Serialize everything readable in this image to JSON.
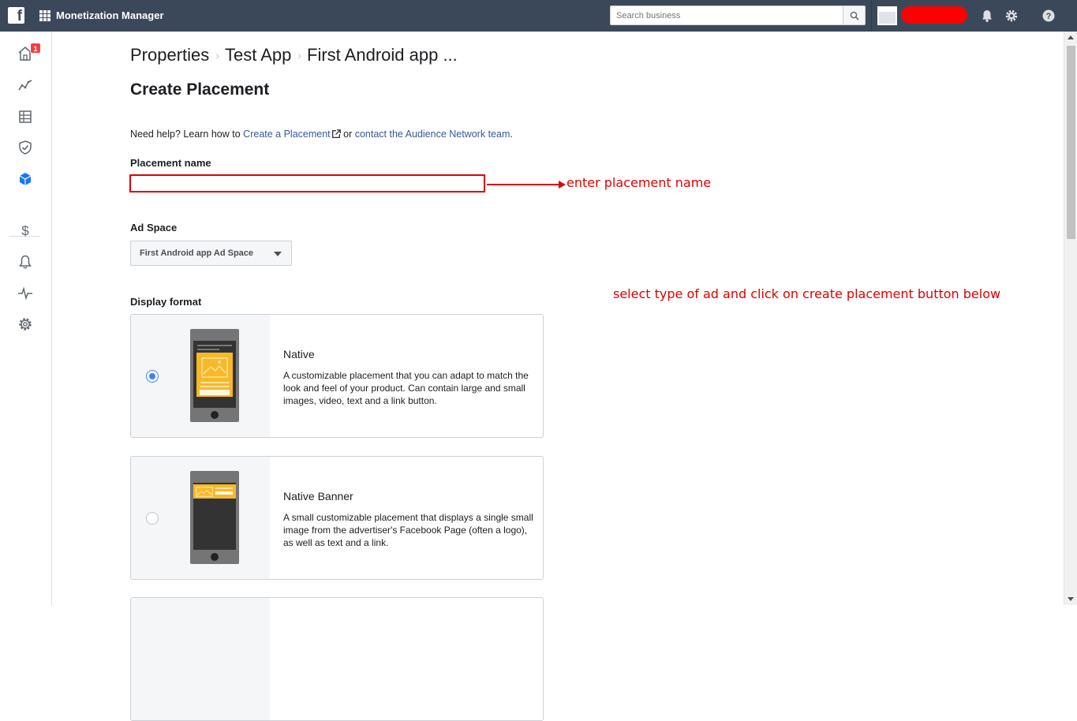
{
  "topbar": {
    "app_title": "Monetization Manager",
    "search_placeholder": "Search business"
  },
  "leftrail": {
    "home_badge": "1",
    "items": [
      "home-icon",
      "analytics-icon",
      "properties-icon",
      "integrity-icon",
      "placements-icon",
      "payout-icon",
      "notifications-icon",
      "activity-icon",
      "settings-icon"
    ]
  },
  "breadcrumb": {
    "items": [
      "Properties",
      "Test App",
      "First Android app ..."
    ]
  },
  "page_title": "Create Placement",
  "help": {
    "prefix": "Need help? Learn how to ",
    "link1": "Create a Placement",
    "middle": " or ",
    "link2": "contact the Audience Network team",
    "suffix": "."
  },
  "placement_name": {
    "label": "Placement name",
    "value": ""
  },
  "ad_space": {
    "label": "Ad Space",
    "selected": "First Android app Ad Space"
  },
  "display_format": {
    "label": "Display format",
    "options": [
      {
        "title": "Native",
        "description": "A customizable placement that you can adapt to match the look and feel of your product. Can contain large and small images, video, text and a link button.",
        "selected": true
      },
      {
        "title": "Native Banner",
        "description": "A small customizable placement that displays a single small image from the advertiser's Facebook Page (often a logo), as well as text and a link.",
        "selected": false
      }
    ]
  },
  "annotations": {
    "name_hint": "enter placement name",
    "format_hint": "select type of ad and click on create placement button below"
  },
  "colors": {
    "topbar": "#3b4859",
    "link": "#365899",
    "annotation": "#e00000",
    "radio_selected": "#4080ff",
    "phone_accent": "#f7b928"
  }
}
